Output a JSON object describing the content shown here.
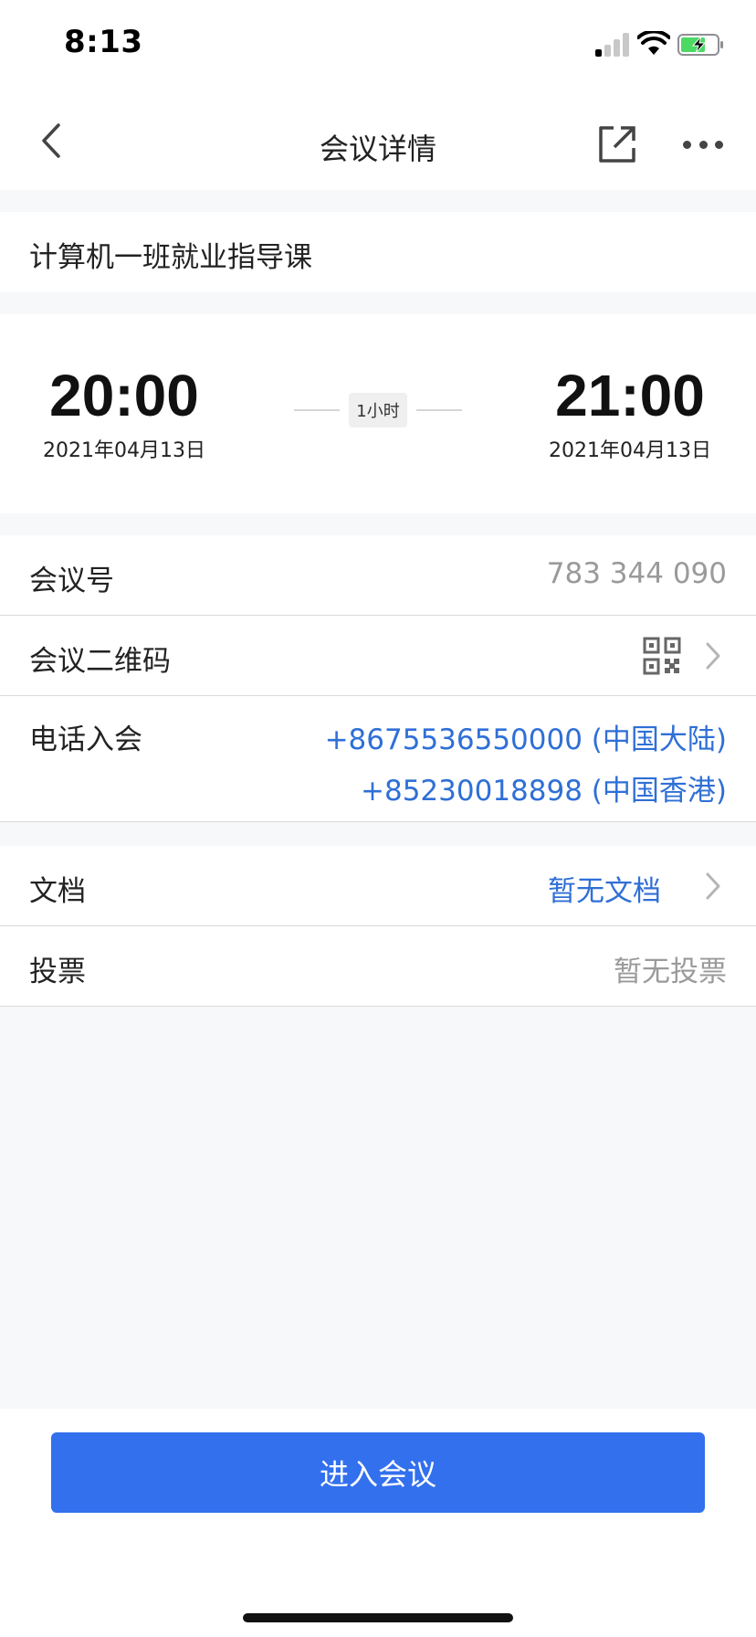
{
  "status_bar": {
    "time": "8:13"
  },
  "nav": {
    "title": "会议详情"
  },
  "meeting": {
    "title": "计算机一班就业指导课",
    "start_time": "20:00",
    "start_date": "2021年04月13日",
    "end_time": "21:00",
    "end_date": "2021年04月13日",
    "duration": "1小时"
  },
  "info": {
    "id_label": "会议号",
    "id_value": "783 344 090",
    "qr_label": "会议二维码",
    "phone_label": "电话入会",
    "phones": [
      "+8675536550000 (中国大陆)",
      "+85230018898 (中国香港)"
    ]
  },
  "extras": {
    "doc_label": "文档",
    "doc_value": "暂无文档",
    "vote_label": "投票",
    "vote_value": "暂无投票"
  },
  "actions": {
    "join_label": "进入会议"
  },
  "colors": {
    "accent": "#3370ee",
    "link": "#2f6fd6",
    "battery": "#4cd964"
  },
  "icons": {
    "back": "chevron-left-icon",
    "share": "external-link-icon",
    "more": "more-dots-icon",
    "qr": "qr-code-icon",
    "chevron": "chevron-right-icon"
  }
}
